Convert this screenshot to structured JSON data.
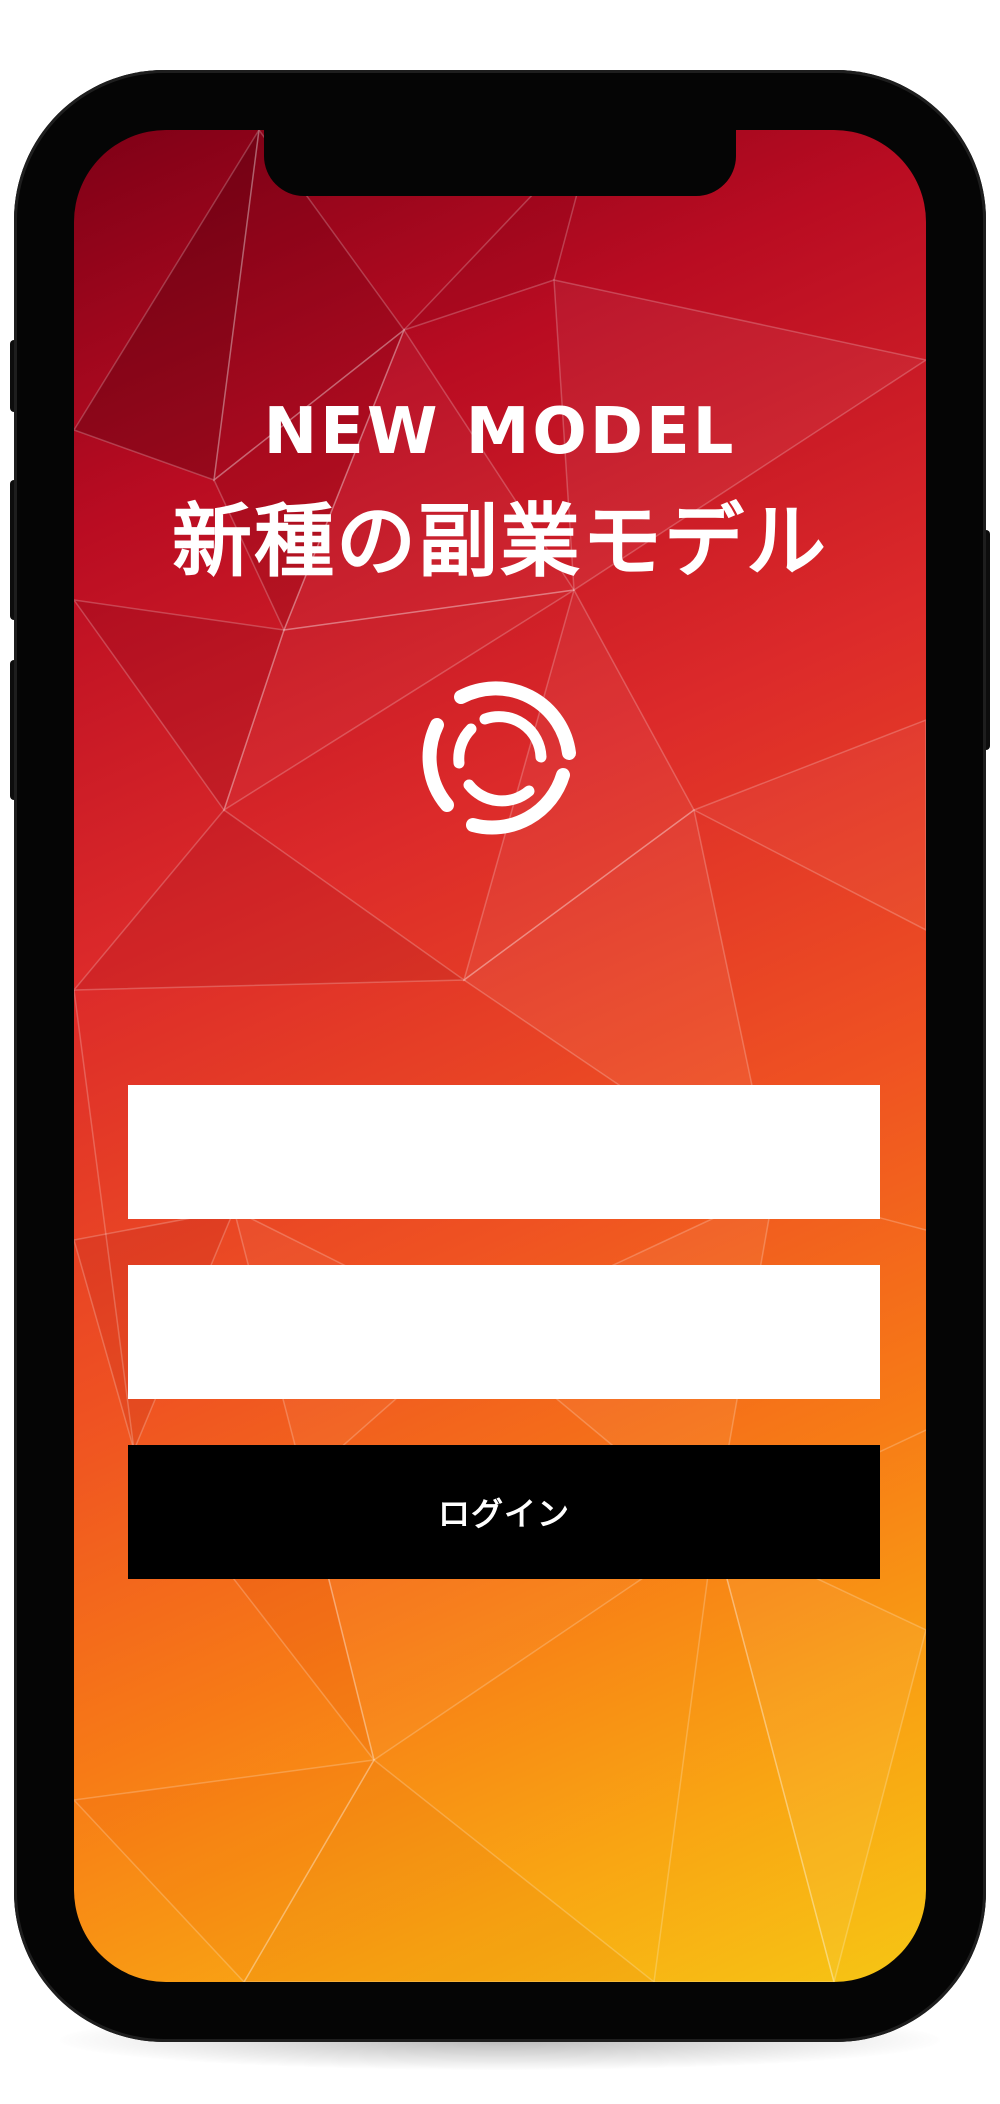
{
  "header": {
    "title_en": "NEW MODEL",
    "title_ja": "新種の副業モデル"
  },
  "brand": {
    "logo_icon": "swirl-logo-icon"
  },
  "login_form": {
    "username_value": "",
    "password_value": "",
    "login_label": "ログイン"
  },
  "colors": {
    "gradient_start": "#7e0016",
    "gradient_mid": "#ef5222",
    "gradient_end": "#f6c614",
    "button": "#000000",
    "field": "#ffffff",
    "text": "#ffffff"
  }
}
